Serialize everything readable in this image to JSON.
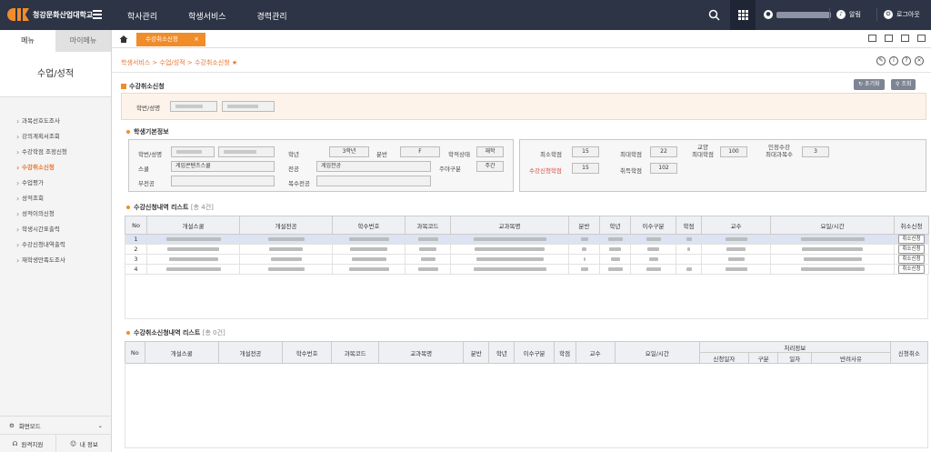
{
  "app": {
    "logo_text": "청강문화산업대학교",
    "brand_color": "#f08c2a"
  },
  "gnb": {
    "items": [
      "학사관리",
      "학생서비스",
      "경력관리"
    ]
  },
  "top_right": {
    "alarm": "알림",
    "logout": "로그아웃"
  },
  "sidebar": {
    "tab_menu": "메뉴",
    "tab_mymenu": "마이메뉴",
    "title": "수업/성적",
    "items": [
      "과목선호도조사",
      "강의계획서조회",
      "수강학점 조정신청",
      "수강취소신청",
      "수업평가",
      "성적조회",
      "성적이의신청",
      "학생시간표출력",
      "수강신청내역출력",
      "재학생만족도조사"
    ],
    "active_index": 3,
    "mode": "화면모드",
    "remote": "원격지원",
    "myinfo": "내 정보"
  },
  "tab": {
    "label": "수강취소신청",
    "close": "×"
  },
  "breadcrumb": {
    "text": "학생서비스 > 수업/성적 > 수강취소신청",
    "star": "★"
  },
  "section_main": {
    "title": "수강취소신청",
    "reset": "초기화",
    "search": "조회"
  },
  "search": {
    "label": "학번/성명"
  },
  "basic_info": {
    "title": "학생기본정보",
    "labels": {
      "id_name": "학번/성명",
      "grade": "학년",
      "class": "분반",
      "status": "학적상태",
      "school": "스쿨",
      "major": "전공",
      "day_night": "주야구분",
      "minor": "부전공",
      "double_major": "복수전공"
    },
    "values": {
      "grade": "3학년",
      "class": "F",
      "status": "재학",
      "school": "게임콘텐츠스쿨",
      "major": "게임전공",
      "day_night": "주간"
    },
    "credit_labels": {
      "min": "최소학점",
      "max": "최대학점",
      "liberal_max": "교양\n최대학점",
      "approved_max": "인정수강\n최대과목수",
      "applied": "수강신청학점",
      "obtained": "취득학점"
    },
    "credit_values": {
      "min": "15",
      "max": "22",
      "liberal_max": "100",
      "approved_max": "3",
      "applied": "15",
      "obtained": "102"
    }
  },
  "enroll_list": {
    "title": "수강신청내역 리스트",
    "count": "[총 4건]",
    "headers": [
      "No",
      "개설스쿨",
      "개설전공",
      "학수번호",
      "과목코드",
      "교과목명",
      "분반",
      "학년",
      "이수구분",
      "학점",
      "교수",
      "요일/시간",
      "취소신청"
    ],
    "rows": [
      "1",
      "2",
      "3",
      "4"
    ],
    "cancel_label": "취소신청"
  },
  "cancel_list": {
    "title": "수강취소신청내역 리스트",
    "count": "[총 0건]",
    "headers": [
      "No",
      "개설스쿨",
      "개설전공",
      "학수번호",
      "과목코드",
      "교과목명",
      "분반",
      "학년",
      "이수구분",
      "학점",
      "교수",
      "요일/시간",
      "처리정보",
      "신청취소"
    ],
    "sub_headers": [
      "신청일자",
      "구분",
      "일자",
      "반려사유"
    ]
  }
}
